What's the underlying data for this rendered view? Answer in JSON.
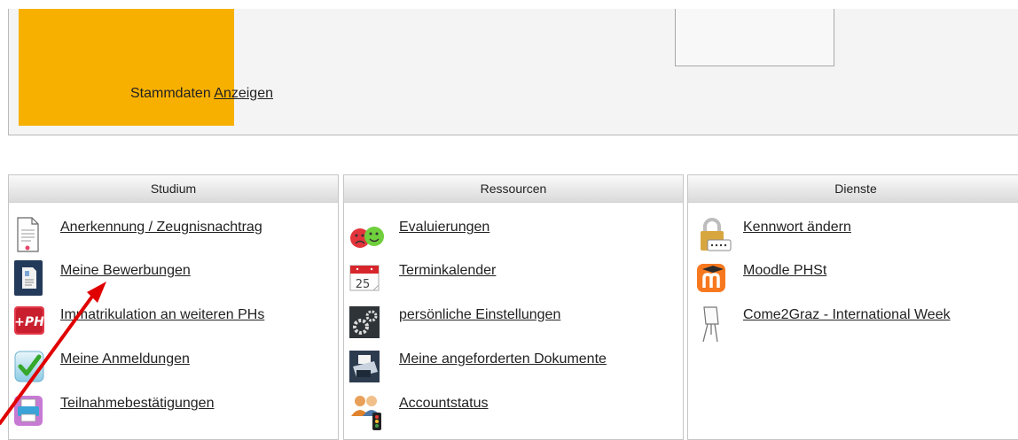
{
  "top": {
    "label": "Stammdaten",
    "link": "Anzeigen"
  },
  "columns": [
    {
      "title": "Studium",
      "items": [
        {
          "label": "Anerkennung / Zeugnisnachtrag",
          "icon": "document-icon"
        },
        {
          "label": "Meine Bewerbungen",
          "icon": "application-form-icon"
        },
        {
          "label": "Immatrikulation an weiteren PHs",
          "icon": "plus-ph-icon"
        },
        {
          "label": "Meine Anmeldungen",
          "icon": "checkmark-icon"
        },
        {
          "label": "Teilnahmebestätigungen",
          "icon": "printer-icon"
        }
      ]
    },
    {
      "title": "Ressourcen",
      "items": [
        {
          "label": "Evaluierungen",
          "icon": "smiley-faces-icon"
        },
        {
          "label": "Terminkalender",
          "icon": "calendar-icon",
          "badge": "25"
        },
        {
          "label": "persönliche Einstellungen",
          "icon": "gears-icon"
        },
        {
          "label": "Meine angeforderten Dokumente",
          "icon": "fax-printer-icon"
        },
        {
          "label": "Accountstatus",
          "icon": "users-traffic-light-icon"
        }
      ]
    },
    {
      "title": "Dienste",
      "items": [
        {
          "label": "Kennwort ändern",
          "icon": "padlock-icon"
        },
        {
          "label": "Moodle PHSt",
          "icon": "moodle-icon"
        },
        {
          "label": "Come2Graz - International Week",
          "icon": "flipchart-icon"
        }
      ]
    }
  ],
  "annotation": {
    "icon": "red-arrow-icon",
    "color": "#e00000"
  },
  "colors": {
    "orange": "#f8b000",
    "panel": "#f4f4f4"
  }
}
